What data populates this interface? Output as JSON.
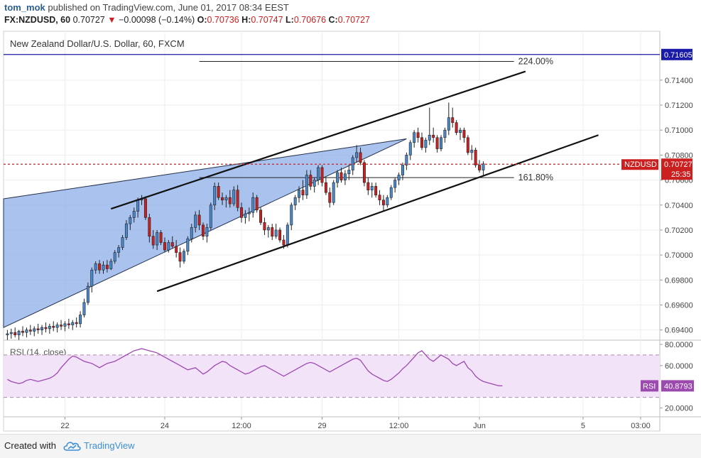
{
  "header": {
    "user": "tom_mok",
    "published_text": "published on TradingView.com, June 01, 2017 08:34 EEST",
    "symbol_label": "FX:NZDUSD, 60",
    "last": "0.70727",
    "change": "−0.00098 (−0.14%)",
    "open_label": "O:",
    "open": "0.70736",
    "high_label": "H:",
    "high": "0.70747",
    "low_label": "L:",
    "low": "0.70676",
    "close_label": "C:",
    "close": "0.70727"
  },
  "footer": {
    "created_with": "Created with",
    "brand": "TradingView"
  },
  "colors": {
    "bull": "#4a88cc",
    "bear": "#cc2020",
    "wedge_fill": "#8eaee8",
    "rsi_line": "#9c4ab0",
    "rsi_band": "#f3e3f9",
    "level_line": "#1a1aa8"
  },
  "chart_data": [
    {
      "type": "candlestick",
      "title": "New Zealand Dollar/U.S. Dollar, 60, FXCM",
      "ylim": [
        0.6933,
        0.7178
      ],
      "x_range": [
        -1,
        170
      ],
      "y_ticks": [
        "0.71400",
        "0.71200",
        "0.71000",
        "0.70800",
        "0.70600",
        "0.70400",
        "0.70200",
        "0.70000",
        "0.69800",
        "0.69600",
        "0.69400"
      ],
      "x_ticks": [
        {
          "label": "22",
          "x": 15
        },
        {
          "label": "24",
          "x": 41
        },
        {
          "label": "12:00",
          "x": 61
        },
        {
          "label": "29",
          "x": 82
        },
        {
          "label": "12:00",
          "x": 102
        },
        {
          "label": "Jun",
          "x": 123
        },
        {
          "label": "5",
          "x": 150
        },
        {
          "label": "03:00",
          "x": 165
        }
      ],
      "horizontal_level": {
        "value": 0.71605,
        "label": "0.71605"
      },
      "price_marker": {
        "symbol": "NZDUSD",
        "value": 0.70727,
        "label": "0.70727",
        "countdown": "25:35"
      },
      "fib_levels": [
        {
          "label": "224.00%",
          "value": 0.7155,
          "x_start": 50,
          "x_end": 132
        },
        {
          "label": "161.80%",
          "value": 0.7062,
          "x_start": 50,
          "x_end": 132
        }
      ],
      "channel_upper": {
        "x1": 27,
        "y1": 0.7037,
        "x2": 135,
        "y2": 0.7147
      },
      "channel_lower": {
        "x1": 39,
        "y1": 0.6971,
        "x2": 154,
        "y2": 0.7096
      },
      "wedge": [
        {
          "x": -1,
          "y": 0.7045
        },
        {
          "x": 104,
          "y": 0.7093
        },
        {
          "x": -1,
          "y": 0.6942
        }
      ],
      "candles": [
        [
          0,
          0.6936,
          0.694,
          0.6932,
          0.6937
        ],
        [
          1,
          0.6937,
          0.6941,
          0.6933,
          0.6938
        ],
        [
          2,
          0.6938,
          0.6942,
          0.6934,
          0.6936
        ],
        [
          3,
          0.6936,
          0.694,
          0.6932,
          0.6939
        ],
        [
          4,
          0.6939,
          0.6943,
          0.6935,
          0.6938
        ],
        [
          5,
          0.6938,
          0.6942,
          0.6934,
          0.694
        ],
        [
          6,
          0.694,
          0.6944,
          0.6936,
          0.6939
        ],
        [
          7,
          0.6939,
          0.6943,
          0.6935,
          0.6941
        ],
        [
          8,
          0.6941,
          0.6945,
          0.6937,
          0.694
        ],
        [
          9,
          0.694,
          0.6944,
          0.6936,
          0.6942
        ],
        [
          10,
          0.6942,
          0.6946,
          0.6938,
          0.6941
        ],
        [
          11,
          0.6941,
          0.6945,
          0.6937,
          0.6943
        ],
        [
          12,
          0.6943,
          0.6947,
          0.6939,
          0.6942
        ],
        [
          13,
          0.6942,
          0.6946,
          0.6938,
          0.6944
        ],
        [
          14,
          0.6944,
          0.6948,
          0.694,
          0.6943
        ],
        [
          15,
          0.6943,
          0.6947,
          0.6939,
          0.6945
        ],
        [
          16,
          0.6945,
          0.6949,
          0.6941,
          0.6944
        ],
        [
          17,
          0.6944,
          0.6948,
          0.694,
          0.6946
        ],
        [
          18,
          0.6946,
          0.695,
          0.6942,
          0.6945
        ],
        [
          19,
          0.6945,
          0.6955,
          0.6942,
          0.6952
        ],
        [
          20,
          0.6952,
          0.6965,
          0.695,
          0.6962
        ],
        [
          21,
          0.6962,
          0.6978,
          0.696,
          0.6975
        ],
        [
          22,
          0.6975,
          0.699,
          0.697,
          0.6988
        ],
        [
          23,
          0.6988,
          0.6995,
          0.6985,
          0.6993
        ],
        [
          24,
          0.6993,
          0.6996,
          0.6985,
          0.6988
        ],
        [
          25,
          0.6988,
          0.6995,
          0.6985,
          0.6992
        ],
        [
          26,
          0.6992,
          0.6996,
          0.6986,
          0.6989
        ],
        [
          27,
          0.6989,
          0.6997,
          0.6988,
          0.6995
        ],
        [
          28,
          0.6995,
          0.7004,
          0.6993,
          0.7002
        ],
        [
          29,
          0.7002,
          0.7008,
          0.6998,
          0.7006
        ],
        [
          30,
          0.7006,
          0.7016,
          0.7004,
          0.7014
        ],
        [
          31,
          0.7014,
          0.7028,
          0.7012,
          0.7025
        ],
        [
          32,
          0.7025,
          0.7032,
          0.702,
          0.703
        ],
        [
          33,
          0.703,
          0.7038,
          0.7026,
          0.7035
        ],
        [
          34,
          0.7035,
          0.7046,
          0.703,
          0.7044
        ],
        [
          35,
          0.7044,
          0.7048,
          0.704,
          0.7045
        ],
        [
          36,
          0.7045,
          0.7047,
          0.7028,
          0.703
        ],
        [
          37,
          0.703,
          0.7033,
          0.701,
          0.7015
        ],
        [
          38,
          0.7015,
          0.702,
          0.7005,
          0.7008
        ],
        [
          39,
          0.7008,
          0.702,
          0.7004,
          0.7018
        ],
        [
          40,
          0.7018,
          0.702,
          0.7008,
          0.701
        ],
        [
          41,
          0.701,
          0.7014,
          0.7002,
          0.7004
        ],
        [
          42,
          0.7004,
          0.7012,
          0.7002,
          0.701
        ],
        [
          43,
          0.701,
          0.7015,
          0.7005,
          0.7007
        ],
        [
          44,
          0.7007,
          0.7012,
          0.6998,
          0.7002
        ],
        [
          45,
          0.7002,
          0.7006,
          0.699,
          0.6995
        ],
        [
          46,
          0.6995,
          0.7005,
          0.6993,
          0.7003
        ],
        [
          47,
          0.7003,
          0.7015,
          0.7,
          0.7013
        ],
        [
          48,
          0.7013,
          0.7025,
          0.701,
          0.7022
        ],
        [
          49,
          0.7022,
          0.7035,
          0.7018,
          0.7032
        ],
        [
          50,
          0.7032,
          0.7036,
          0.702,
          0.7024
        ],
        [
          51,
          0.7024,
          0.7026,
          0.7012,
          0.7015
        ],
        [
          52,
          0.7015,
          0.7025,
          0.701,
          0.7022
        ],
        [
          53,
          0.7022,
          0.7042,
          0.702,
          0.704
        ],
        [
          54,
          0.704,
          0.7058,
          0.7036,
          0.7055
        ],
        [
          55,
          0.7055,
          0.7058,
          0.7044,
          0.7046
        ],
        [
          56,
          0.7046,
          0.705,
          0.704,
          0.7044
        ],
        [
          57,
          0.7044,
          0.7048,
          0.7038,
          0.7046
        ],
        [
          58,
          0.7046,
          0.7052,
          0.7038,
          0.7041
        ],
        [
          59,
          0.7041,
          0.7055,
          0.7039,
          0.7052
        ],
        [
          60,
          0.7052,
          0.7056,
          0.7035,
          0.7038
        ],
        [
          61,
          0.7038,
          0.7042,
          0.7026,
          0.703
        ],
        [
          62,
          0.703,
          0.7036,
          0.7025,
          0.7033
        ],
        [
          63,
          0.7033,
          0.7038,
          0.7027,
          0.7034
        ],
        [
          64,
          0.7034,
          0.705,
          0.703,
          0.7046
        ],
        [
          65,
          0.7046,
          0.7048,
          0.7034,
          0.7036
        ],
        [
          66,
          0.7036,
          0.7038,
          0.7024,
          0.7026
        ],
        [
          67,
          0.7026,
          0.703,
          0.7016,
          0.702
        ],
        [
          68,
          0.702,
          0.7024,
          0.7014,
          0.7022
        ],
        [
          69,
          0.7022,
          0.7025,
          0.7012,
          0.7015
        ],
        [
          70,
          0.7015,
          0.7025,
          0.7013,
          0.702
        ],
        [
          71,
          0.702,
          0.7022,
          0.701,
          0.7012
        ],
        [
          72,
          0.7012,
          0.7016,
          0.7005,
          0.7008
        ],
        [
          73,
          0.7008,
          0.7026,
          0.7006,
          0.7024
        ],
        [
          74,
          0.7024,
          0.7042,
          0.702,
          0.704
        ],
        [
          75,
          0.704,
          0.7048,
          0.7036,
          0.7046
        ],
        [
          76,
          0.7046,
          0.7055,
          0.7042,
          0.7052
        ],
        [
          77,
          0.7052,
          0.706,
          0.7044,
          0.7048
        ],
        [
          78,
          0.7048,
          0.7068,
          0.7045,
          0.7064
        ],
        [
          79,
          0.7064,
          0.7068,
          0.7052,
          0.7055
        ],
        [
          80,
          0.7055,
          0.7062,
          0.705,
          0.706
        ],
        [
          81,
          0.706,
          0.7072,
          0.7056,
          0.707
        ],
        [
          82,
          0.707,
          0.7072,
          0.7055,
          0.7058
        ],
        [
          83,
          0.7058,
          0.7062,
          0.7048,
          0.705
        ],
        [
          84,
          0.705,
          0.7054,
          0.7038,
          0.7042
        ],
        [
          85,
          0.7042,
          0.706,
          0.704,
          0.7058
        ],
        [
          86,
          0.7058,
          0.7068,
          0.7054,
          0.7066
        ],
        [
          87,
          0.7066,
          0.707,
          0.7058,
          0.706
        ],
        [
          88,
          0.706,
          0.7068,
          0.7056,
          0.7065
        ],
        [
          89,
          0.7065,
          0.7072,
          0.706,
          0.7068
        ],
        [
          90,
          0.7068,
          0.708,
          0.7064,
          0.7078
        ],
        [
          91,
          0.7078,
          0.7088,
          0.7074,
          0.7082
        ],
        [
          92,
          0.7082,
          0.7086,
          0.7072,
          0.7074
        ],
        [
          93,
          0.7074,
          0.7076,
          0.7055,
          0.7058
        ],
        [
          94,
          0.7058,
          0.7062,
          0.7048,
          0.7052
        ],
        [
          95,
          0.7052,
          0.7058,
          0.7046,
          0.7055
        ],
        [
          96,
          0.7055,
          0.7058,
          0.7046,
          0.7048
        ],
        [
          97,
          0.7048,
          0.7052,
          0.704,
          0.7044
        ],
        [
          98,
          0.7044,
          0.7048,
          0.7035,
          0.704
        ],
        [
          99,
          0.704,
          0.7048,
          0.7038,
          0.7046
        ],
        [
          100,
          0.7046,
          0.7056,
          0.7044,
          0.7054
        ],
        [
          101,
          0.7054,
          0.7062,
          0.705,
          0.706
        ],
        [
          102,
          0.706,
          0.7066,
          0.7056,
          0.7064
        ],
        [
          103,
          0.7064,
          0.7074,
          0.706,
          0.7072
        ],
        [
          104,
          0.7072,
          0.7082,
          0.7068,
          0.708
        ],
        [
          105,
          0.708,
          0.7092,
          0.7076,
          0.709
        ],
        [
          106,
          0.709,
          0.71,
          0.7086,
          0.7098
        ],
        [
          107,
          0.7098,
          0.7102,
          0.709,
          0.7094
        ],
        [
          108,
          0.7094,
          0.7098,
          0.7084,
          0.7086
        ],
        [
          109,
          0.7086,
          0.7094,
          0.7082,
          0.7092
        ],
        [
          110,
          0.7092,
          0.7118,
          0.7088,
          0.7096
        ],
        [
          111,
          0.7096,
          0.7102,
          0.709,
          0.7094
        ],
        [
          112,
          0.7094,
          0.7096,
          0.7082,
          0.7085
        ],
        [
          113,
          0.7085,
          0.7096,
          0.7083,
          0.7094
        ],
        [
          114,
          0.7094,
          0.7102,
          0.709,
          0.71
        ],
        [
          115,
          0.71,
          0.7122,
          0.7096,
          0.711
        ],
        [
          116,
          0.711,
          0.7118,
          0.7102,
          0.7106
        ],
        [
          117,
          0.7106,
          0.7108,
          0.7096,
          0.7098
        ],
        [
          118,
          0.7098,
          0.7102,
          0.7092,
          0.71
        ],
        [
          119,
          0.71,
          0.7102,
          0.709,
          0.7094
        ],
        [
          120,
          0.7094,
          0.7096,
          0.708,
          0.7082
        ],
        [
          121,
          0.7082,
          0.7088,
          0.7076,
          0.7084
        ],
        [
          122,
          0.7084,
          0.7086,
          0.707,
          0.7072
        ],
        [
          123,
          0.7072,
          0.7076,
          0.7066,
          0.7068
        ],
        [
          124,
          0.7068,
          0.7075,
          0.7064,
          0.7073
        ]
      ]
    },
    {
      "type": "line",
      "title": "RSI (14, close)",
      "ylim": [
        13,
        82
      ],
      "y_ticks": [
        "80.0000",
        "60.0000",
        "20.0000"
      ],
      "band": [
        30,
        70
      ],
      "last_value": "40.8793",
      "series": [
        {
          "values": [
            47,
            45,
            44,
            43,
            44,
            46,
            47,
            46,
            45,
            46,
            47,
            48,
            50,
            53,
            58,
            62,
            66,
            69,
            68,
            66,
            64,
            63,
            62,
            60,
            58,
            60,
            62,
            63,
            64,
            66,
            68,
            70,
            72,
            74,
            75,
            76,
            75,
            74,
            73,
            72,
            70,
            68,
            66,
            64,
            62,
            60,
            58,
            56,
            57,
            58,
            55,
            52,
            54,
            57,
            60,
            62,
            64,
            63,
            60,
            58,
            56,
            54,
            52,
            53,
            55,
            57,
            59,
            60,
            58,
            56,
            54,
            52,
            50,
            52,
            54,
            56,
            58,
            60,
            62,
            63,
            62,
            60,
            58,
            56,
            54,
            56,
            58,
            60,
            62,
            64,
            66,
            67,
            65,
            60,
            55,
            52,
            50,
            48,
            46,
            45,
            47,
            50,
            53,
            57,
            60,
            64,
            68,
            72,
            74,
            70,
            66,
            64,
            67,
            70,
            68,
            66,
            62,
            60,
            62,
            64,
            58,
            55,
            50,
            47,
            45,
            44,
            43,
            42,
            41,
            40.88
          ]
        }
      ]
    }
  ]
}
